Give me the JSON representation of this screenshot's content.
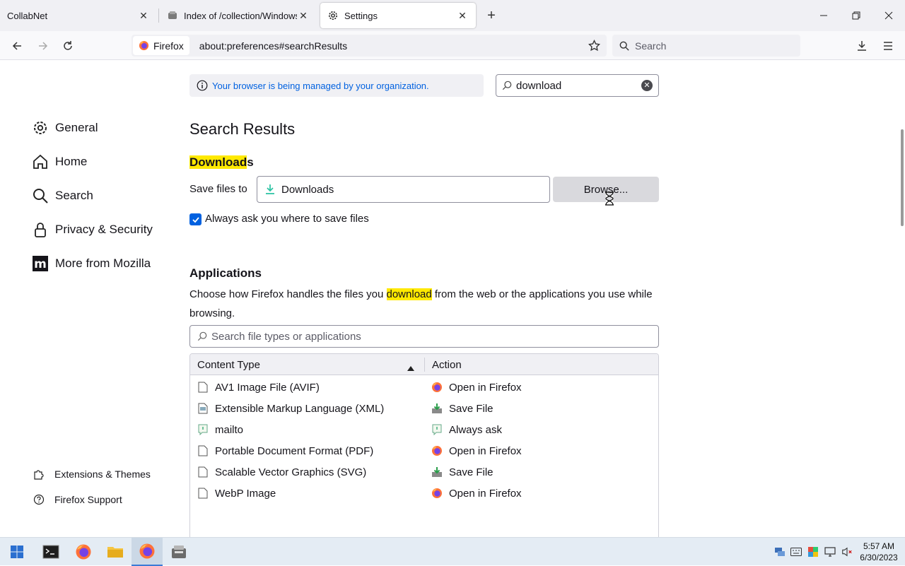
{
  "tabs": [
    {
      "title": "CollabNet"
    },
    {
      "title": "Index of /collection/Windows &"
    },
    {
      "title": "Settings"
    }
  ],
  "navbar": {
    "identity_label": "Firefox",
    "url": "about:preferences#searchResults",
    "search_placeholder": "Search"
  },
  "sidebar": {
    "items": [
      {
        "label": "General",
        "icon": "gear-icon"
      },
      {
        "label": "Home",
        "icon": "home-icon"
      },
      {
        "label": "Search",
        "icon": "search-icon"
      },
      {
        "label": "Privacy & Security",
        "icon": "lock-icon"
      },
      {
        "label": "More from Mozilla",
        "icon": "mozilla-icon"
      }
    ],
    "footer": [
      {
        "label": "Extensions & Themes",
        "icon": "puzzle-icon"
      },
      {
        "label": "Firefox Support",
        "icon": "help-icon"
      }
    ]
  },
  "main": {
    "managed_notice": "Your browser is being managed by your organization.",
    "search_value": "download",
    "page_title": "Search Results",
    "downloads": {
      "heading_hl": "Download",
      "heading_rest": "s",
      "save_files_label": "Save files to",
      "folder": "Downloads",
      "browse_label": "Browse...",
      "always_ask_label": "Always ask you where to save files",
      "always_ask_checked": true
    },
    "applications": {
      "heading": "Applications",
      "desc_before": "Choose how Firefox handles the files you ",
      "desc_hl": "download",
      "desc_after": " from the web or the applications you use while browsing.",
      "filter_placeholder": "Search file types or applications",
      "columns": [
        "Content Type",
        "Action"
      ],
      "rows": [
        {
          "type": "AV1 Image File (AVIF)",
          "action": "Open in Firefox",
          "type_icon": "file-icon",
          "action_icon": "firefox-icon"
        },
        {
          "type": "Extensible Markup Language (XML)",
          "action": "Save File",
          "type_icon": "xml-file-icon",
          "action_icon": "save-file-icon"
        },
        {
          "type": "mailto",
          "action": "Always ask",
          "type_icon": "ask-icon",
          "action_icon": "ask-icon"
        },
        {
          "type": "Portable Document Format (PDF)",
          "action": "Open in Firefox",
          "type_icon": "file-icon",
          "action_icon": "firefox-icon"
        },
        {
          "type": "Scalable Vector Graphics (SVG)",
          "action": "Save File",
          "type_icon": "file-icon",
          "action_icon": "save-file-icon"
        },
        {
          "type": "WebP Image",
          "action": "Open in Firefox",
          "type_icon": "file-icon",
          "action_icon": "firefox-icon"
        }
      ]
    }
  },
  "taskbar": {
    "time": "5:57 AM",
    "date": "6/30/2023"
  },
  "colors": {
    "accent": "#0061e0",
    "highlight": "#ffe900"
  }
}
